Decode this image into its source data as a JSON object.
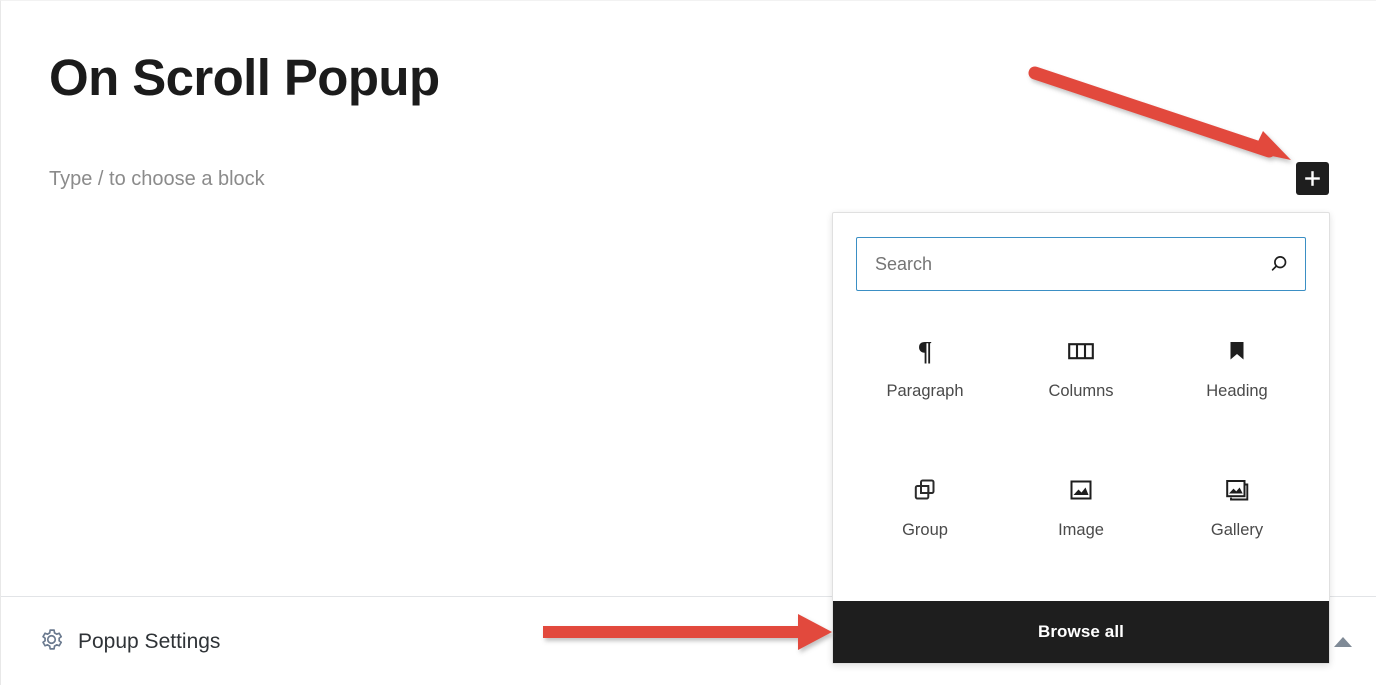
{
  "editor": {
    "post_title": "On Scroll Popup",
    "block_placeholder": "Type / to choose a block",
    "add_block_button_label": "Add block"
  },
  "inserter": {
    "search": {
      "placeholder": "Search",
      "value": "",
      "icon": "search-icon"
    },
    "blocks": [
      {
        "label": "Paragraph",
        "icon": "paragraph-icon"
      },
      {
        "label": "Columns",
        "icon": "columns-icon"
      },
      {
        "label": "Heading",
        "icon": "heading-icon"
      },
      {
        "label": "Group",
        "icon": "group-icon"
      },
      {
        "label": "Image",
        "icon": "image-icon"
      },
      {
        "label": "Gallery",
        "icon": "gallery-icon"
      }
    ],
    "browse_all_label": "Browse all"
  },
  "bottom_bar": {
    "settings_label": "Popup Settings",
    "settings_icon": "gear-icon",
    "collapse_icon": "caret-up-icon"
  },
  "annotations": [
    {
      "name": "arrow-to-add-block",
      "direction": "diagonal-down-right",
      "color": "#e2483d"
    },
    {
      "name": "arrow-to-browse-all",
      "direction": "right",
      "color": "#e2483d"
    }
  ],
  "colors": {
    "accent_dark": "#1e1e1e",
    "search_border": "#3b8fc4",
    "annotation_red": "#e2483d",
    "gear_gray": "#6b7a8f"
  }
}
